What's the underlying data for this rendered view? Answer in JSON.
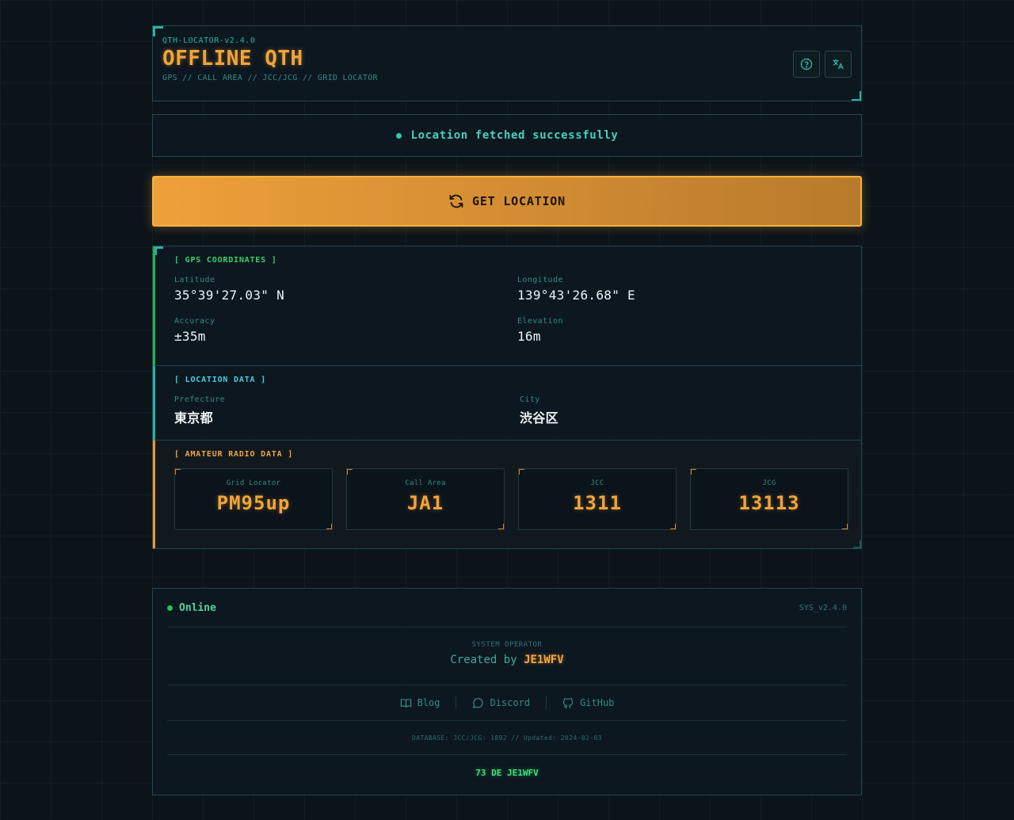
{
  "header": {
    "version": "QTH-LOCATOR-v2.4.0",
    "title": "OFFLINE QTH",
    "subtitle": "GPS // CALL AREA // JCC/JCG // GRID LOCATOR",
    "help_icon": "help-circle-icon",
    "lang_icon": "translate-icon"
  },
  "status": {
    "message": "Location fetched successfully",
    "color": "#2ec9a9"
  },
  "action": {
    "get_location_label": "GET LOCATION",
    "icon": "refresh-icon",
    "color": "#eea03a"
  },
  "gps": {
    "heading": "[ GPS COORDINATES ]",
    "latitude_label": "Latitude",
    "latitude": "35°39'27.03\" N",
    "longitude_label": "Longitude",
    "longitude": "139°43'26.68\" E",
    "accuracy_label": "Accuracy",
    "accuracy": "±35m",
    "elevation_label": "Elevation",
    "elevation": "16m"
  },
  "location": {
    "heading": "[ LOCATION DATA ]",
    "prefecture_label": "Prefecture",
    "prefecture": "東京都",
    "city_label": "City",
    "city": "渋谷区"
  },
  "radio": {
    "heading": "[ AMATEUR RADIO DATA ]",
    "cards": [
      {
        "label": "Grid Locator",
        "value": "PM95up"
      },
      {
        "label": "Call Area",
        "value": "JA1"
      },
      {
        "label": "JCC",
        "value": "1311"
      },
      {
        "label": "JCG",
        "value": "13113"
      }
    ]
  },
  "footer": {
    "status": "Online",
    "sys_version": "SYS_v2.4.0",
    "operator_label": "SYSTEM OPERATOR",
    "created_by": "Created by",
    "operator": "JE1WFV",
    "links": [
      {
        "label": "Blog",
        "icon": "book-icon"
      },
      {
        "label": "Discord",
        "icon": "chat-bubble-icon"
      },
      {
        "label": "GitHub",
        "icon": "github-icon"
      }
    ],
    "database": "DATABASE: JCC/JCG: 1892 // Updated: 2024-02-03",
    "sign_off": "73 DE JE1WFV"
  }
}
